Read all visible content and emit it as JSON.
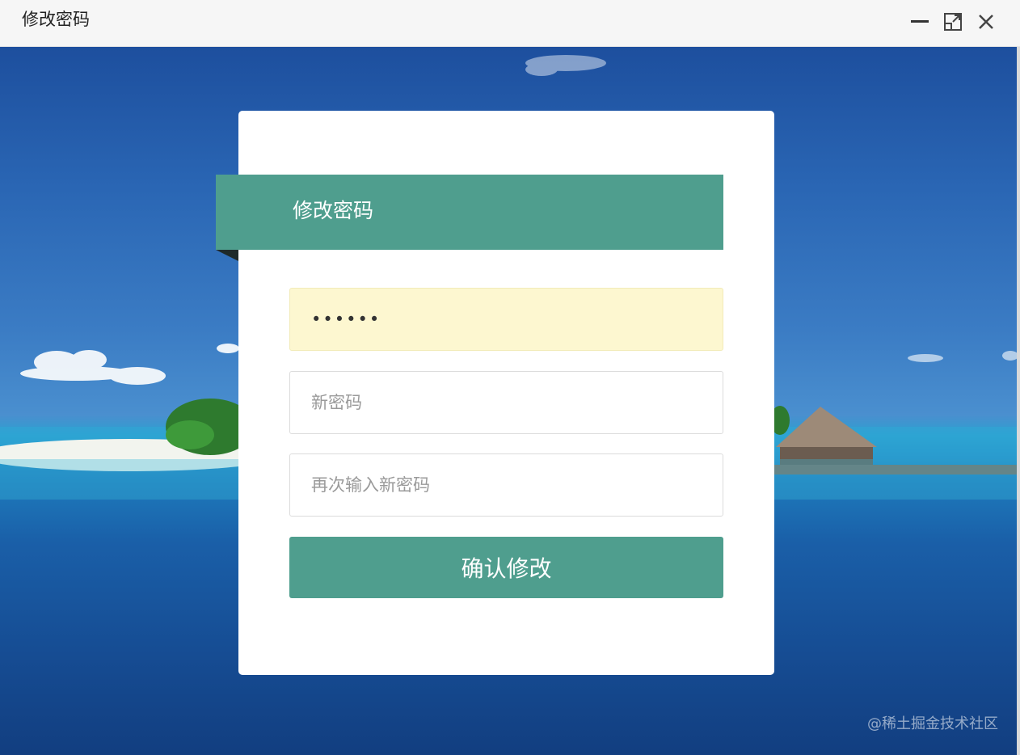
{
  "window": {
    "title": "修改密码"
  },
  "form": {
    "heading": "修改密码",
    "old_password_value": "••••••",
    "new_password_placeholder": "新密码",
    "confirm_password_placeholder": "再次输入新密码",
    "submit_label": "确认修改"
  },
  "watermark": "@稀土掘金技术社区",
  "colors": {
    "accent": "#4f9e8e",
    "autofill_bg": "#fdf7d0",
    "card_bg": "#ffffff"
  },
  "icons": {
    "minimize": "minimize-icon",
    "maximize": "maximize-icon",
    "close": "close-icon"
  }
}
